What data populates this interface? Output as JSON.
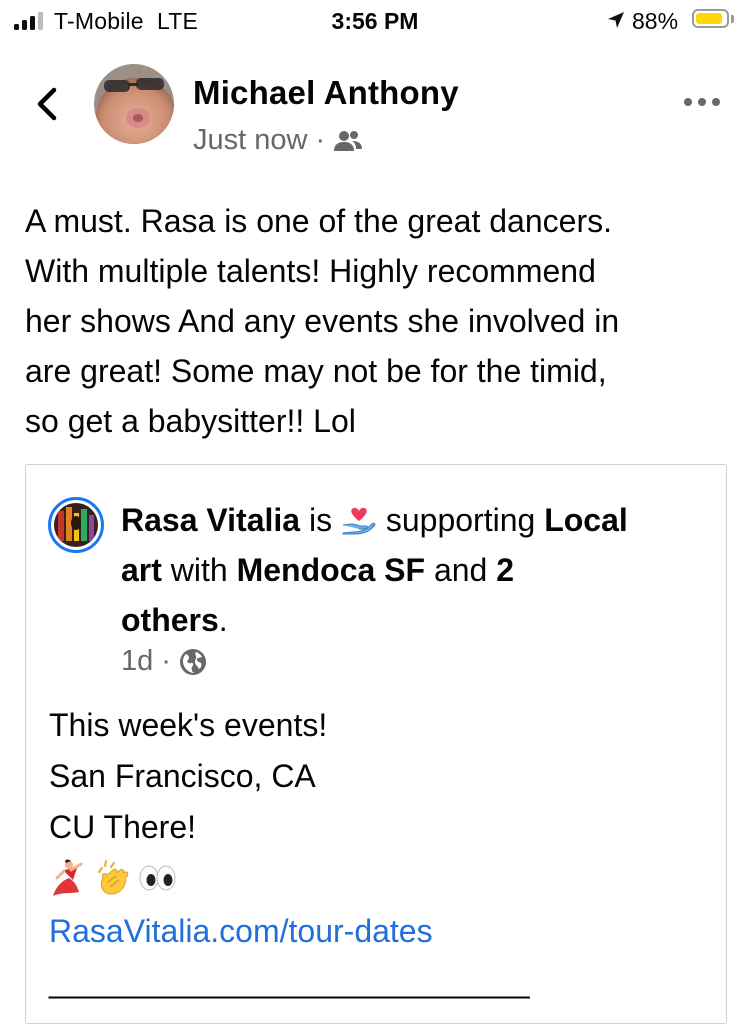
{
  "status_bar": {
    "carrier": "T-Mobile  LTE",
    "time": "3:56 PM",
    "battery_percent": "88%",
    "battery_level": 0.88,
    "signal_bars": 3,
    "signal_bars_total": 4,
    "battery_color": "#ffd60a"
  },
  "header": {
    "author_name": "Michael Anthony",
    "timestamp": "Just now",
    "separator": "·",
    "audience_icon": "friends-icon",
    "back_icon": "chevron-left-icon",
    "more_icon": "more-horizontal-icon"
  },
  "post": {
    "lines": [
      "A must. Rasa is one of the great dancers.",
      "With multiple talents! Highly recommend",
      "her shows And any events she involved in",
      "are great! Some may not be for the timid,",
      "so get a babysitter!! Lol"
    ]
  },
  "shared_post": {
    "author": "Rasa Vitalia",
    "is": " is ",
    "activity_icon": "heart-hand-icon",
    "supporting": " supporting ",
    "cause_part1": "Local",
    "cause_part2": "art",
    "with": " with ",
    "tagged": "Mendoca SF",
    "and": " and ",
    "others_count": "2",
    "others": "others",
    "period": ".",
    "timestamp": "1d",
    "separator": "·",
    "privacy_icon": "globe-icon",
    "body_lines": [
      "This week's events!",
      "San Francisco, CA",
      "CU There!"
    ],
    "emojis": [
      "dancer-icon",
      "clapping-hands-icon",
      "eyes-icon"
    ],
    "link": "RasaVitalia.com/tour-dates",
    "divider_text": "___________________________",
    "link_color": "#216fdb"
  }
}
